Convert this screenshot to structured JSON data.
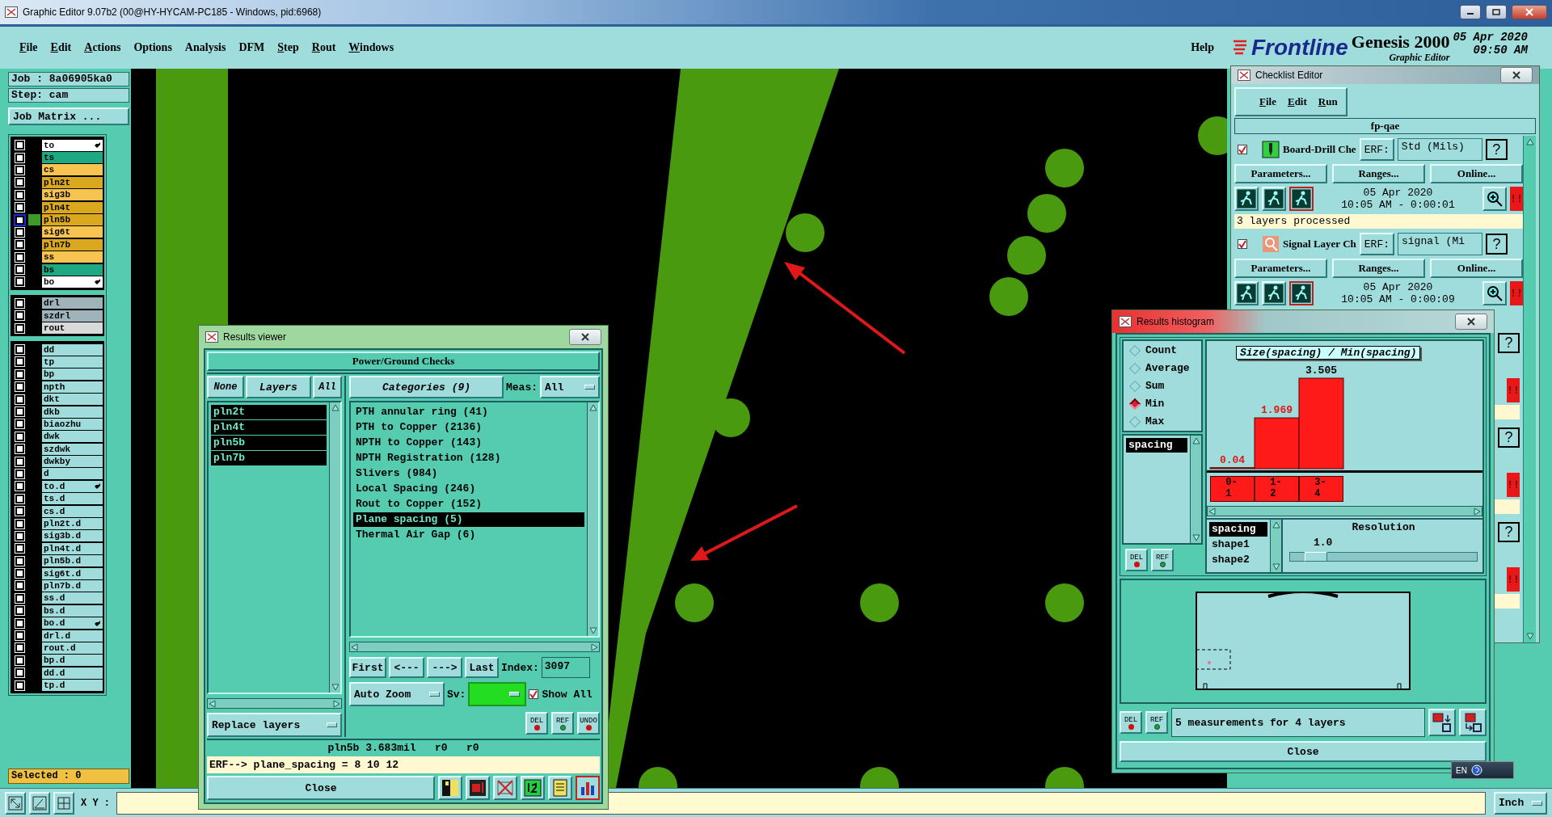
{
  "window": {
    "title": "Graphic Editor 9.07b2 (00@HY-HYCAM-PC185 - Windows, pid:6968)"
  },
  "menu": [
    {
      "label": "File",
      "mnemonic": true
    },
    {
      "label": "Edit",
      "mnemonic": true
    },
    {
      "label": "Actions",
      "mnemonic": true
    },
    {
      "label": "Options",
      "mnemonic": false
    },
    {
      "label": "Analysis",
      "mnemonic": false
    },
    {
      "label": "DFM",
      "mnemonic": false
    },
    {
      "label": "Step",
      "mnemonic": true
    },
    {
      "label": "Rout",
      "mnemonic": true
    },
    {
      "label": "Windows",
      "mnemonic": true
    }
  ],
  "help_menu": {
    "label": "Help"
  },
  "brand": {
    "logo": "Frontline",
    "product": "Genesis 2000",
    "subtitle": "Graphic Editor",
    "date": "05 Apr 2020",
    "time": "09:50 AM"
  },
  "job": {
    "job": "Job : 8a06905ka0",
    "step": "Step: cam",
    "matrix_button": "Job Matrix ..."
  },
  "layer_groups": [
    {
      "layers": [
        {
          "name": "to",
          "color": "#ffffff",
          "checked": false,
          "active": false,
          "marked": true
        },
        {
          "name": "ts",
          "color": "#1fa884",
          "checked": false,
          "active": false,
          "marked": false
        },
        {
          "name": "cs",
          "color": "#f7c452",
          "checked": false,
          "active": false,
          "marked": false
        },
        {
          "name": "pln2t",
          "color": "#d9a81e",
          "checked": false,
          "active": false,
          "marked": false
        },
        {
          "name": "sig3b",
          "color": "#f7c452",
          "checked": false,
          "active": false,
          "marked": false
        },
        {
          "name": "pln4t",
          "color": "#d9a81e",
          "checked": false,
          "active": false,
          "marked": false
        },
        {
          "name": "pln5b",
          "color": "#d9a81e",
          "checked": false,
          "active": true,
          "marked": false
        },
        {
          "name": "sig6t",
          "color": "#f7c452",
          "checked": false,
          "active": false,
          "marked": false
        },
        {
          "name": "pln7b",
          "color": "#d9a81e",
          "checked": false,
          "active": false,
          "marked": false
        },
        {
          "name": "ss",
          "color": "#f7c452",
          "checked": false,
          "active": false,
          "marked": false
        },
        {
          "name": "bs",
          "color": "#1fa884",
          "checked": false,
          "active": false,
          "marked": false
        },
        {
          "name": "bo",
          "color": "#ffffff",
          "checked": false,
          "active": false,
          "marked": true
        }
      ]
    },
    {
      "layers": [
        {
          "name": "drl",
          "color": "#9fb3bb",
          "checked": false,
          "active": false,
          "marked": false
        },
        {
          "name": "szdrl",
          "color": "#9fb3bb",
          "checked": false,
          "active": false,
          "marked": false
        },
        {
          "name": "rout",
          "color": "#d8dada",
          "checked": false,
          "active": false,
          "marked": false
        }
      ]
    },
    {
      "layers": [
        {
          "name": "dd",
          "color": "#a0dcdc",
          "checked": false,
          "active": false,
          "marked": false
        },
        {
          "name": "tp",
          "color": "#a0dcdc",
          "checked": false,
          "active": false,
          "marked": false
        },
        {
          "name": "bp",
          "color": "#a0dcdc",
          "checked": false,
          "active": false,
          "marked": false
        },
        {
          "name": "npth",
          "color": "#a0dcdc",
          "checked": false,
          "active": false,
          "marked": false
        },
        {
          "name": "dkt",
          "color": "#a0dcdc",
          "checked": false,
          "active": false,
          "marked": false
        },
        {
          "name": "dkb",
          "color": "#a0dcdc",
          "checked": false,
          "active": false,
          "marked": false
        },
        {
          "name": "biaozhu",
          "color": "#a0dcdc",
          "checked": false,
          "active": false,
          "marked": false
        },
        {
          "name": "dwk",
          "color": "#a0dcdc",
          "checked": false,
          "active": false,
          "marked": false
        },
        {
          "name": "szdwk",
          "color": "#a0dcdc",
          "checked": false,
          "active": false,
          "marked": false
        },
        {
          "name": "dwkby",
          "color": "#a0dcdc",
          "checked": false,
          "active": false,
          "marked": false
        },
        {
          "name": "d",
          "color": "#a0dcdc",
          "checked": false,
          "active": false,
          "marked": false
        },
        {
          "name": "to.d",
          "color": "#a0dcdc",
          "checked": false,
          "active": false,
          "marked": true
        },
        {
          "name": "ts.d",
          "color": "#a0dcdc",
          "checked": false,
          "active": false,
          "marked": false
        },
        {
          "name": "cs.d",
          "color": "#a0dcdc",
          "checked": false,
          "active": false,
          "marked": false
        },
        {
          "name": "pln2t.d",
          "color": "#a0dcdc",
          "checked": false,
          "active": false,
          "marked": false
        },
        {
          "name": "sig3b.d",
          "color": "#a0dcdc",
          "checked": false,
          "active": false,
          "marked": false
        },
        {
          "name": "pln4t.d",
          "color": "#a0dcdc",
          "checked": false,
          "active": false,
          "marked": false
        },
        {
          "name": "pln5b.d",
          "color": "#a0dcdc",
          "checked": false,
          "active": false,
          "marked": false
        },
        {
          "name": "sig6t.d",
          "color": "#a0dcdc",
          "checked": false,
          "active": false,
          "marked": false
        },
        {
          "name": "pln7b.d",
          "color": "#a0dcdc",
          "checked": false,
          "active": false,
          "marked": false
        },
        {
          "name": "ss.d",
          "color": "#a0dcdc",
          "checked": false,
          "active": false,
          "marked": false
        },
        {
          "name": "bs.d",
          "color": "#a0dcdc",
          "checked": false,
          "active": false,
          "marked": false
        },
        {
          "name": "bo.d",
          "color": "#a0dcdc",
          "checked": false,
          "active": false,
          "marked": true
        },
        {
          "name": "drl.d",
          "color": "#a0dcdc",
          "checked": false,
          "active": false,
          "marked": false
        },
        {
          "name": "rout.d",
          "color": "#a0dcdc",
          "checked": false,
          "active": false,
          "marked": false
        },
        {
          "name": "bp.d",
          "color": "#a0dcdc",
          "checked": false,
          "active": false,
          "marked": false
        },
        {
          "name": "dd.d",
          "color": "#a0dcdc",
          "checked": false,
          "active": false,
          "marked": false
        },
        {
          "name": "tp.d",
          "color": "#a0dcdc",
          "checked": false,
          "active": false,
          "marked": false
        }
      ]
    }
  ],
  "selected_count": "Selected : 0",
  "bottom_bar": {
    "xy_label": "X Y :",
    "units": "Inch"
  },
  "results_viewer": {
    "title": "Results viewer",
    "heading": "Power/Ground Checks",
    "none_button": "None",
    "layers_button": "Layers",
    "all_button": "All",
    "categories_button": "Categories (9)",
    "meas_label": "Meas:",
    "meas_value": "All",
    "layers": [
      {
        "name": "pln2t",
        "selected": true
      },
      {
        "name": "pln4t",
        "selected": true
      },
      {
        "name": "pln5b",
        "selected": true
      },
      {
        "name": "pln7b",
        "selected": true
      }
    ],
    "categories": [
      {
        "label": "PTH annular ring (41)",
        "selected": false
      },
      {
        "label": "PTH to Copper (2136)",
        "selected": false
      },
      {
        "label": "NPTH to Copper (143)",
        "selected": false
      },
      {
        "label": "NPTH Registration (128)",
        "selected": false
      },
      {
        "label": "Slivers (984)",
        "selected": false
      },
      {
        "label": "Local Spacing (246)",
        "selected": false
      },
      {
        "label": "Rout to Copper (152)",
        "selected": false
      },
      {
        "label": "Plane spacing (5)",
        "selected": true
      },
      {
        "label": "Thermal Air Gap (6)",
        "selected": false
      }
    ],
    "nav": [
      "First",
      "<---",
      "--->",
      "Last"
    ],
    "index_label": "Index:",
    "index_value": "3097",
    "zoom_mode": "Auto Zoom",
    "sv_label": "Sv:",
    "show_all": {
      "label": "Show All",
      "checked": true
    },
    "replace_mode": "Replace layers",
    "tools": [
      "DEL",
      "REF",
      "UNDO"
    ],
    "info": "pln5b 3.683mil   r0   r0",
    "erf": "ERF--> plane_spacing = 8 10 12",
    "close": "Close",
    "icon_tools": [
      {
        "kind": "split",
        "selected": false
      },
      {
        "kind": "record",
        "selected": false
      },
      {
        "kind": "crossed",
        "selected": false
      },
      {
        "kind": "numbers",
        "selected": false
      },
      {
        "kind": "report",
        "selected": false
      },
      {
        "kind": "histogram",
        "selected": true
      }
    ]
  },
  "histogram": {
    "title": "Results histogram",
    "modes": [
      {
        "label": "Count",
        "selected": false
      },
      {
        "label": "Average",
        "selected": false
      },
      {
        "label": "Sum",
        "selected": false
      },
      {
        "label": "Min",
        "selected": true
      },
      {
        "label": "Max",
        "selected": false
      }
    ],
    "attributes": [
      {
        "label": "spacing",
        "selected": true
      }
    ],
    "chart_data": {
      "type": "bar",
      "title": "Size(spacing) / Min(spacing)",
      "categories": [
        "0-1",
        "1-2",
        "3-4"
      ],
      "values": [
        0.04,
        1.969,
        3.505
      ],
      "data_labels": true
    },
    "size_attributes": [
      {
        "label": "spacing",
        "selected": true
      },
      {
        "label": "shape1",
        "selected": false
      },
      {
        "label": "shape2",
        "selected": false
      }
    ],
    "resolution_label": "Resolution",
    "resolution_value": "1.0",
    "resolution": {
      "level": 0.08
    },
    "tools": [
      "DEL",
      "REF"
    ],
    "bottom_tools": [
      "DEL",
      "REF"
    ],
    "summary": "5 measurements for 4 layers",
    "close": "Close"
  },
  "checklist": {
    "title": "Checklist Editor",
    "menu": [
      "File",
      "Edit",
      "Run"
    ],
    "name": "fp-qae",
    "checks": [
      {
        "kind": "full",
        "checked": true,
        "title": "Board-Drill Che",
        "erf_label": "ERF:",
        "erf_value": "Std (Mils)",
        "help": "?",
        "buttons": [
          "Parameters...",
          "Ranges...",
          "Online..."
        ],
        "date": "05 Apr 2020",
        "time": "10:05 AM - 0:00:01",
        "alarm": "!!",
        "status": "3 layers processed"
      },
      {
        "kind": "full",
        "checked": true,
        "title": "Signal Layer Ch",
        "erf_label": "ERF:",
        "erf_value": "signal (Mi",
        "help": "?",
        "buttons": [
          "Parameters...",
          "Ranges...",
          "Online..."
        ],
        "date": "05 Apr 2020",
        "time": "10:05 AM - 0:00:09",
        "alarm": "!!"
      },
      {
        "kind": "partial",
        "help": "?",
        "alarm": "!!"
      },
      {
        "kind": "partial",
        "help": "?",
        "alarm": "!!"
      },
      {
        "kind": "partial",
        "help": "?",
        "alarm": "!!"
      }
    ]
  },
  "language_bar": {
    "label": "EN"
  }
}
